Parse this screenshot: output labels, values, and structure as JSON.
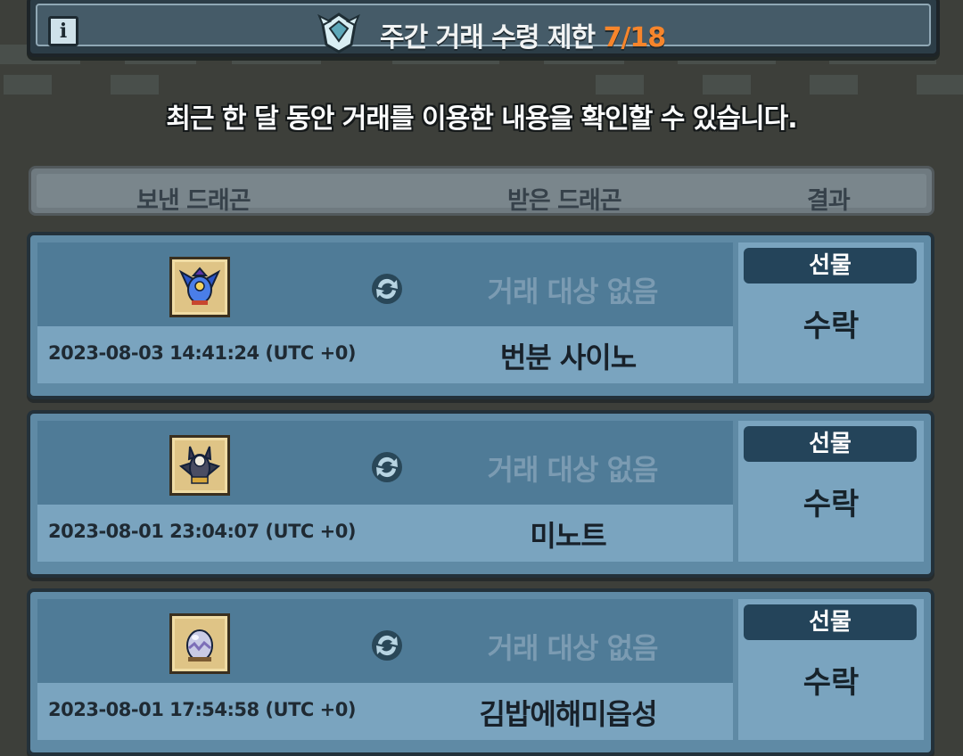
{
  "header": {
    "title": "주간 거래 수령 제한",
    "count": "7/18",
    "info_icon": "info-icon",
    "emblem_icon": "trade-emblem-icon"
  },
  "subtitle": "최근 한 달 동안 거래를 이용한 내용을 확인할 수 있습니다.",
  "columns": {
    "sent": "보낸 드래곤",
    "received": "받은 드래곤",
    "result": "결과"
  },
  "colors": {
    "accent_orange": "#f7852b",
    "row_blue": "#5f8aa5",
    "badge_navy": "#24445a"
  },
  "trades": [
    {
      "dragon_icon": "blue-winged-dragon-icon",
      "swap_icon": "swap-icon",
      "no_target": "거래 대상 없음",
      "timestamp": "2023-08-03 14:41:24 (UTC +0)",
      "received": "번분 사이노",
      "badge": "선물",
      "result": "수락"
    },
    {
      "dragon_icon": "dark-gold-dragon-icon",
      "swap_icon": "swap-icon",
      "no_target": "거래 대상 없음",
      "timestamp": "2023-08-01 23:04:07 (UTC +0)",
      "received": "미노트",
      "badge": "선물",
      "result": "수락"
    },
    {
      "dragon_icon": "dragon-egg-icon",
      "swap_icon": "swap-icon",
      "no_target": "거래 대상 없음",
      "timestamp": "2023-08-01 17:54:58 (UTC +0)",
      "received": "김밥에해미읍성",
      "badge": "선물",
      "result": "수락"
    }
  ]
}
